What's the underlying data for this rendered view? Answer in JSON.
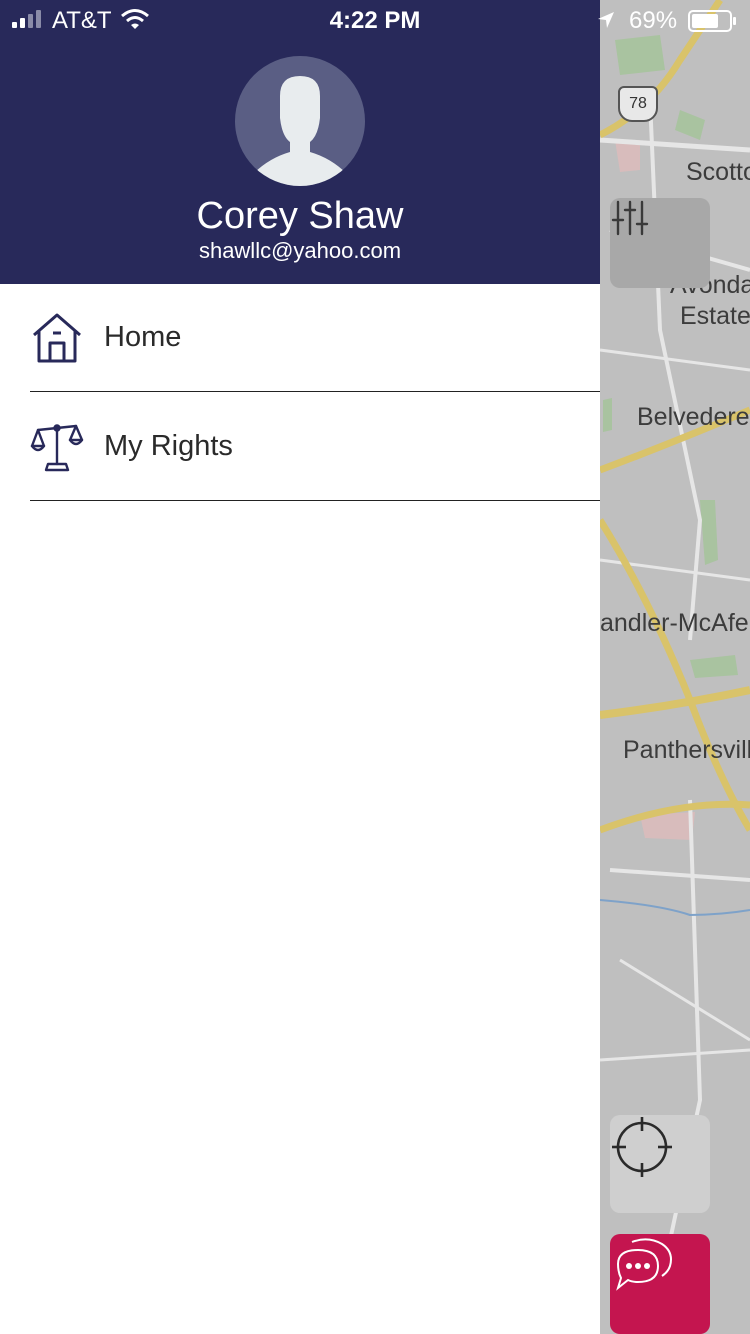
{
  "status_bar": {
    "carrier": "AT&T",
    "time": "4:22 PM",
    "battery": "69%"
  },
  "user": {
    "name": "Corey Shaw",
    "email": "shawllc@yahoo.com"
  },
  "menu": {
    "items": [
      {
        "label": "Home",
        "icon": "house-icon"
      },
      {
        "label": "My Rights",
        "icon": "scales-icon"
      }
    ]
  },
  "map": {
    "route_shield": "78",
    "labels": [
      "Scotto",
      "Avonda",
      "Estate",
      "Belvedere",
      "andler-McAfe",
      "Panthersvill"
    ]
  },
  "colors": {
    "header_bg": "#28295a",
    "chat_button": "#c4154f",
    "drawer_bg": "#ffffff"
  }
}
